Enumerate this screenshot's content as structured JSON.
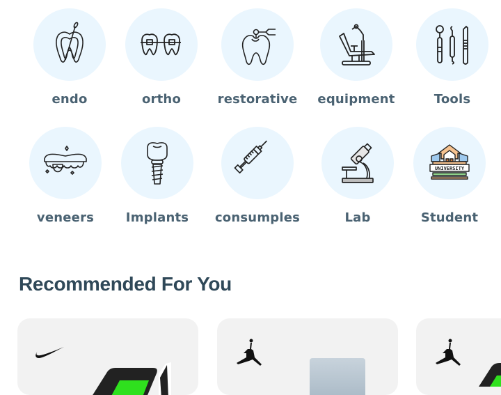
{
  "categories": [
    {
      "label": "endo",
      "icon": "root-canal-tooth-icon"
    },
    {
      "label": "ortho",
      "icon": "braces-teeth-icon"
    },
    {
      "label": "restorative",
      "icon": "drill-tooth-icon"
    },
    {
      "label": "equipment",
      "icon": "dental-chair-icon"
    },
    {
      "label": "Tools",
      "icon": "dental-tools-icon"
    },
    {
      "label": "veneers",
      "icon": "veneers-icon"
    },
    {
      "label": "Implants",
      "icon": "implant-icon"
    },
    {
      "label": "consumples",
      "icon": "syringe-icon"
    },
    {
      "label": "Lab",
      "icon": "microscope-icon"
    },
    {
      "label": "Student",
      "icon": "university-icon"
    }
  ],
  "recommended": {
    "title": "Recommended For You",
    "products": [
      {
        "brand": "Nike",
        "brand_icon": "nike-swoosh-icon"
      },
      {
        "brand": "Jordan",
        "brand_icon": "jumpman-icon"
      },
      {
        "brand": "Jordan",
        "brand_icon": "jumpman-icon"
      }
    ]
  },
  "colors": {
    "circle_bg": "#eaf6fe",
    "label": "#4a6272",
    "heading": "#2f4858",
    "card_bg": "#f2f2f2",
    "shoe_green": "#2fe01e"
  }
}
